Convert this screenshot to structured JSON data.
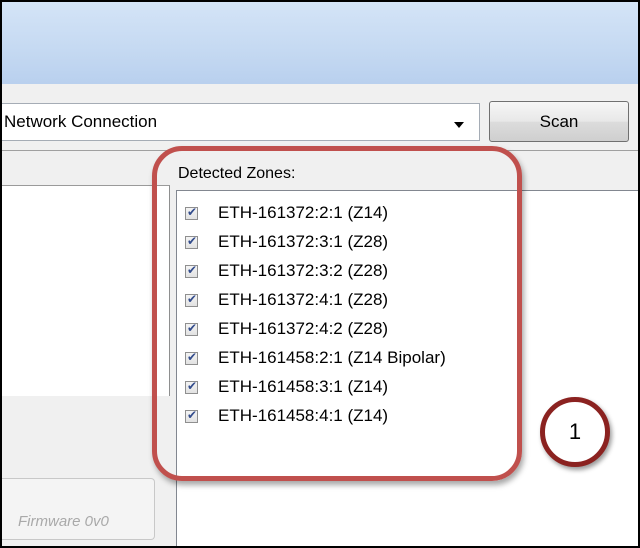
{
  "connection": {
    "selected": "Network Connection"
  },
  "scan_button": {
    "label": "Scan"
  },
  "firmware_button": {
    "label": "Firmware 0v0"
  },
  "zones": {
    "label": "Detected Zones:",
    "items": [
      {
        "label": "ETH-161372:2:1 (Z14)",
        "checked": true
      },
      {
        "label": "ETH-161372:3:1 (Z28)",
        "checked": true
      },
      {
        "label": "ETH-161372:3:2 (Z28)",
        "checked": true
      },
      {
        "label": "ETH-161372:4:1 (Z28)",
        "checked": true
      },
      {
        "label": "ETH-161372:4:2 (Z28)",
        "checked": true
      },
      {
        "label": "ETH-161458:2:1 (Z14 Bipolar)",
        "checked": true
      },
      {
        "label": "ETH-161458:3:1 (Z14)",
        "checked": true
      },
      {
        "label": "ETH-161458:4:1 (Z14)",
        "checked": true
      }
    ]
  },
  "annotation": {
    "number": "1",
    "highlight_color": "#c0504d"
  }
}
